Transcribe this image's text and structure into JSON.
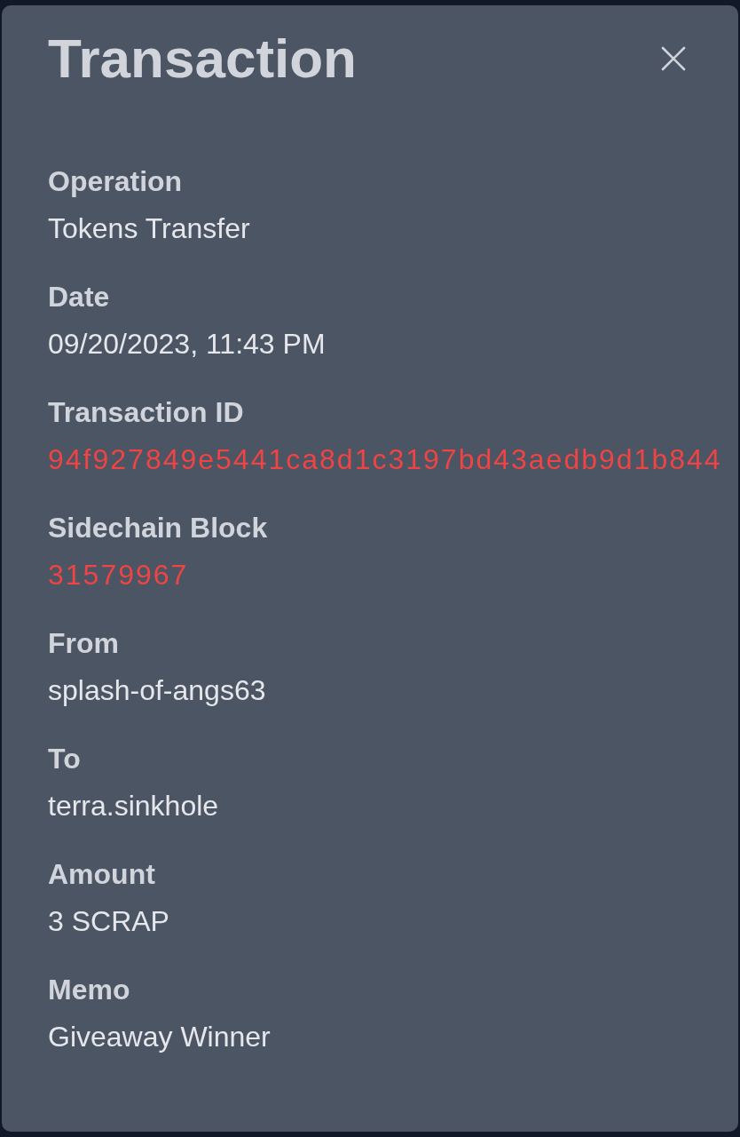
{
  "dialog": {
    "title": "Transaction"
  },
  "fields": [
    {
      "label": "Operation",
      "value": "Tokens Transfer",
      "kind": "text"
    },
    {
      "label": "Date",
      "value": "09/20/2023, 11:43 PM",
      "kind": "text"
    },
    {
      "label": "Transaction ID",
      "value": "94f927849e5441ca8d1c3197bd43aedb9d1b844",
      "kind": "link"
    },
    {
      "label": "Sidechain Block",
      "value": "31579967",
      "kind": "link"
    },
    {
      "label": "From",
      "value": "splash-of-angs63",
      "kind": "text"
    },
    {
      "label": "To",
      "value": "terra.sinkhole",
      "kind": "text"
    },
    {
      "label": "Amount",
      "value": "3 SCRAP",
      "kind": "text"
    },
    {
      "label": "Memo",
      "value": "Giveaway Winner",
      "kind": "text"
    }
  ]
}
